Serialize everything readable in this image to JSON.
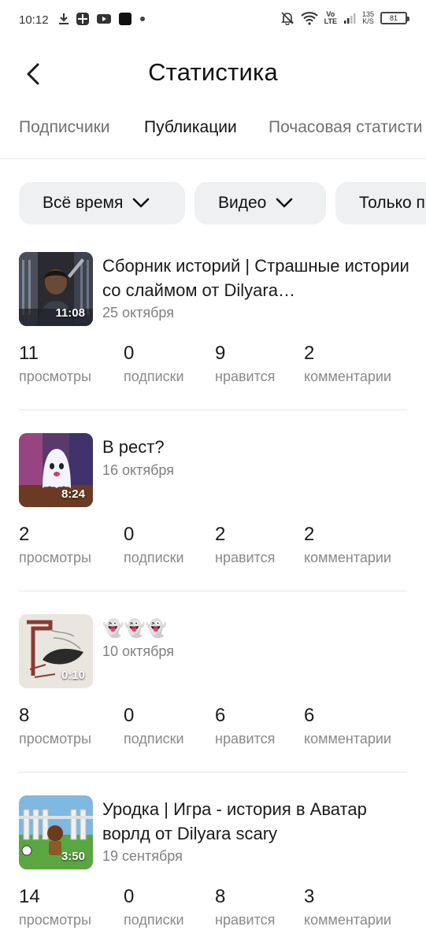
{
  "status_bar": {
    "time": "10:12",
    "volte_top": "Vo",
    "volte_bottom": "LTE",
    "speed_value": "135",
    "speed_unit": "K/S",
    "battery": "81"
  },
  "header": {
    "title": "Статистика"
  },
  "tabs": [
    {
      "label": "Подписчики",
      "active": false
    },
    {
      "label": "Публикации",
      "active": true
    },
    {
      "label": "Почасовая статисти",
      "active": false
    }
  ],
  "filters": [
    {
      "label": "Всё время"
    },
    {
      "label": "Видео"
    },
    {
      "label": "Только п"
    }
  ],
  "posts": [
    {
      "title": "Сборник историй | Страшные истории со слаймом от Dilyara…",
      "date": "25 октября",
      "duration": "11:08",
      "stats": [
        {
          "value": "11",
          "label": "просмотры"
        },
        {
          "value": "0",
          "label": "подписки"
        },
        {
          "value": "9",
          "label": "нравится"
        },
        {
          "value": "2",
          "label": "комментарии"
        }
      ]
    },
    {
      "title": "В рест?",
      "date": "16 октября",
      "duration": "8:24",
      "stats": [
        {
          "value": "2",
          "label": "просмотры"
        },
        {
          "value": "0",
          "label": "подписки"
        },
        {
          "value": "2",
          "label": "нравится"
        },
        {
          "value": "2",
          "label": "комментарии"
        }
      ]
    },
    {
      "title": "👻👻👻",
      "date": "10 октября",
      "duration": "0:10",
      "stats": [
        {
          "value": "8",
          "label": "просмотры"
        },
        {
          "value": "0",
          "label": "подписки"
        },
        {
          "value": "6",
          "label": "нравится"
        },
        {
          "value": "6",
          "label": "комментарии"
        }
      ]
    },
    {
      "title": "Уродка | Игра - история в Аватар ворлд от Dilyara scary",
      "date": "19 сентября",
      "duration": "3:50",
      "stats": [
        {
          "value": "14",
          "label": "просмотры"
        },
        {
          "value": "0",
          "label": "подписки"
        },
        {
          "value": "8",
          "label": "нравится"
        },
        {
          "value": "3",
          "label": "комментарии"
        }
      ]
    }
  ]
}
